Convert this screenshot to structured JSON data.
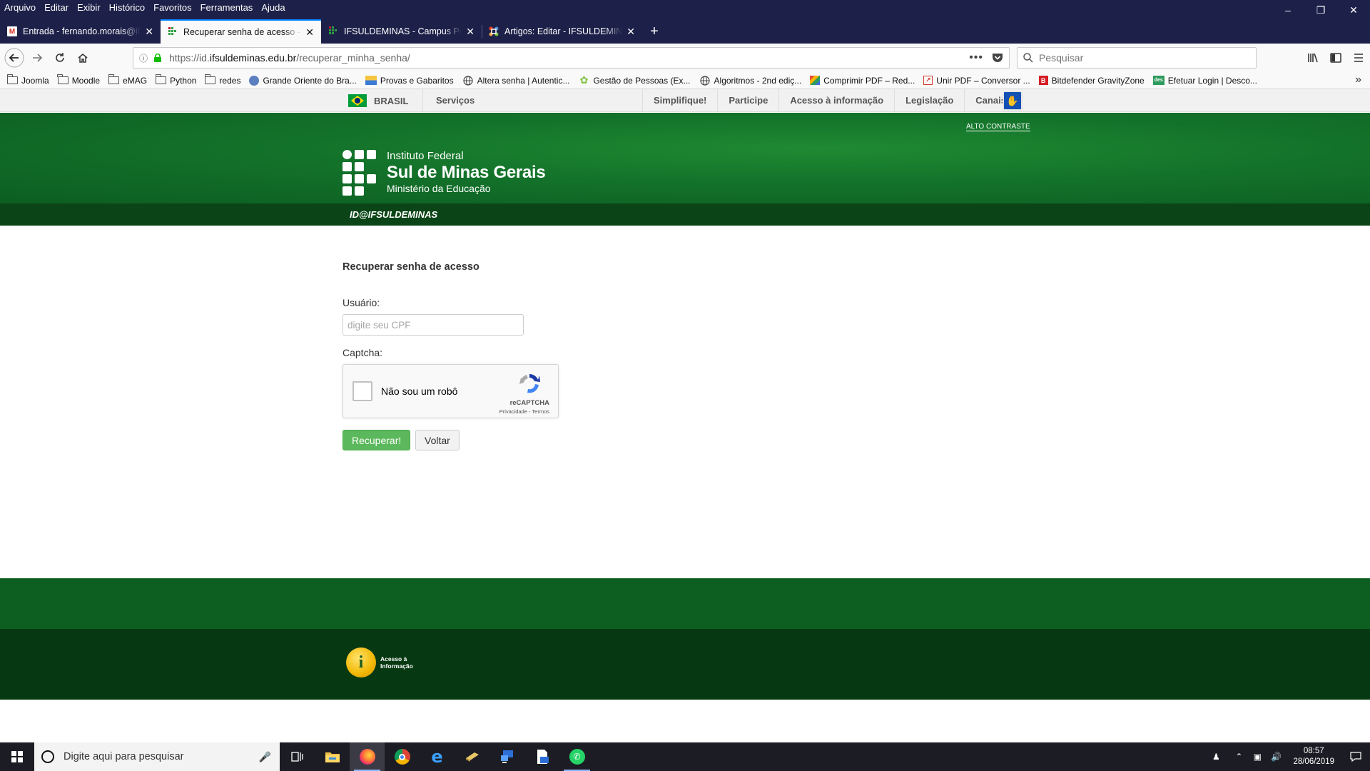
{
  "browser": {
    "menu": [
      "Arquivo",
      "Editar",
      "Exibir",
      "Histórico",
      "Favoritos",
      "Ferramentas",
      "Ajuda"
    ],
    "tabs": [
      {
        "title": "Entrada - fernando.morais@ifsuldeminas.edu.br",
        "icon": "gmail-icon",
        "active": false
      },
      {
        "title": "Recuperar senha de acesso - ID@IFSULDEMINAS",
        "icon": "ifsul-favicon-icon",
        "active": true
      },
      {
        "title": "IFSULDEMINAS - Campus Pouso Alegre",
        "icon": "ifsul-favicon-icon",
        "active": false
      },
      {
        "title": "Artigos: Editar - IFSULDEMINAS",
        "icon": "joomla-icon",
        "active": false
      }
    ],
    "url_prefix": "https://id.",
    "url_domain": "ifsuldeminas.edu.br",
    "url_path": "/recuperar_minha_senha/",
    "search_placeholder": "Pesquisar",
    "bookmarks": [
      {
        "label": "Joomla",
        "type": "folder"
      },
      {
        "label": "Moodle",
        "type": "folder"
      },
      {
        "label": "eMAG",
        "type": "folder"
      },
      {
        "label": "Python",
        "type": "folder"
      },
      {
        "label": "redes",
        "type": "folder"
      },
      {
        "label": "Grande Oriente do Bra...",
        "type": "site",
        "color": "#5b7fbf"
      },
      {
        "label": "Provas e Gabaritos",
        "type": "site",
        "color": "#3a7bd5"
      },
      {
        "label": "Altera senha | Autentic...",
        "type": "globe"
      },
      {
        "label": "Gestão de Pessoas (Ex...",
        "type": "site",
        "color": "#7cc242"
      },
      {
        "label": "Algoritmos - 2nd ediç...",
        "type": "globe"
      },
      {
        "label": "Comprimir PDF – Red...",
        "type": "site",
        "color": "#e04e39"
      },
      {
        "label": "Unir PDF – Conversor ...",
        "type": "site",
        "color": "#d23a2a"
      },
      {
        "label": "Bitdefender GravityZone",
        "type": "site",
        "color": "#d51e26"
      },
      {
        "label": "Efetuar Login | Desco...",
        "type": "site",
        "color": "#2e9a5d"
      }
    ]
  },
  "govbar": {
    "brasil": "BRASIL",
    "servicos": "Serviços",
    "links": [
      "Simplifique!",
      "Participe",
      "Acesso à informação",
      "Legislação",
      "Canais"
    ]
  },
  "header": {
    "alto_contraste": "ALTO CONTRASTE",
    "line1": "Instituto Federal",
    "line2": "Sul de Minas Gerais",
    "line3": "Ministério da Educação",
    "section": "ID@IFSULDEMINAS"
  },
  "form": {
    "title": "Recuperar senha de acesso",
    "usuario_label": "Usuário:",
    "usuario_placeholder": "digite seu CPF",
    "usuario_value": "",
    "captcha_label": "Captcha:",
    "recaptcha_text": "Não sou um robô",
    "recaptcha_brand": "reCAPTCHA",
    "recaptcha_terms": "Privacidade - Termos",
    "recuperar_button": "Recuperar!",
    "voltar_button": "Voltar"
  },
  "footer": {
    "acesso_text": "Acesso à Informação"
  },
  "taskbar": {
    "search_placeholder": "Digite aqui para pesquisar",
    "apps": [
      "task-view-icon",
      "file-explorer-icon",
      "firefox-icon",
      "chrome-icon",
      "edge-icon",
      "app-icon",
      "remote-desktop-icon",
      "printer-app-icon",
      "whatsapp-icon"
    ],
    "time": "08:57",
    "date": "28/06/2019"
  }
}
